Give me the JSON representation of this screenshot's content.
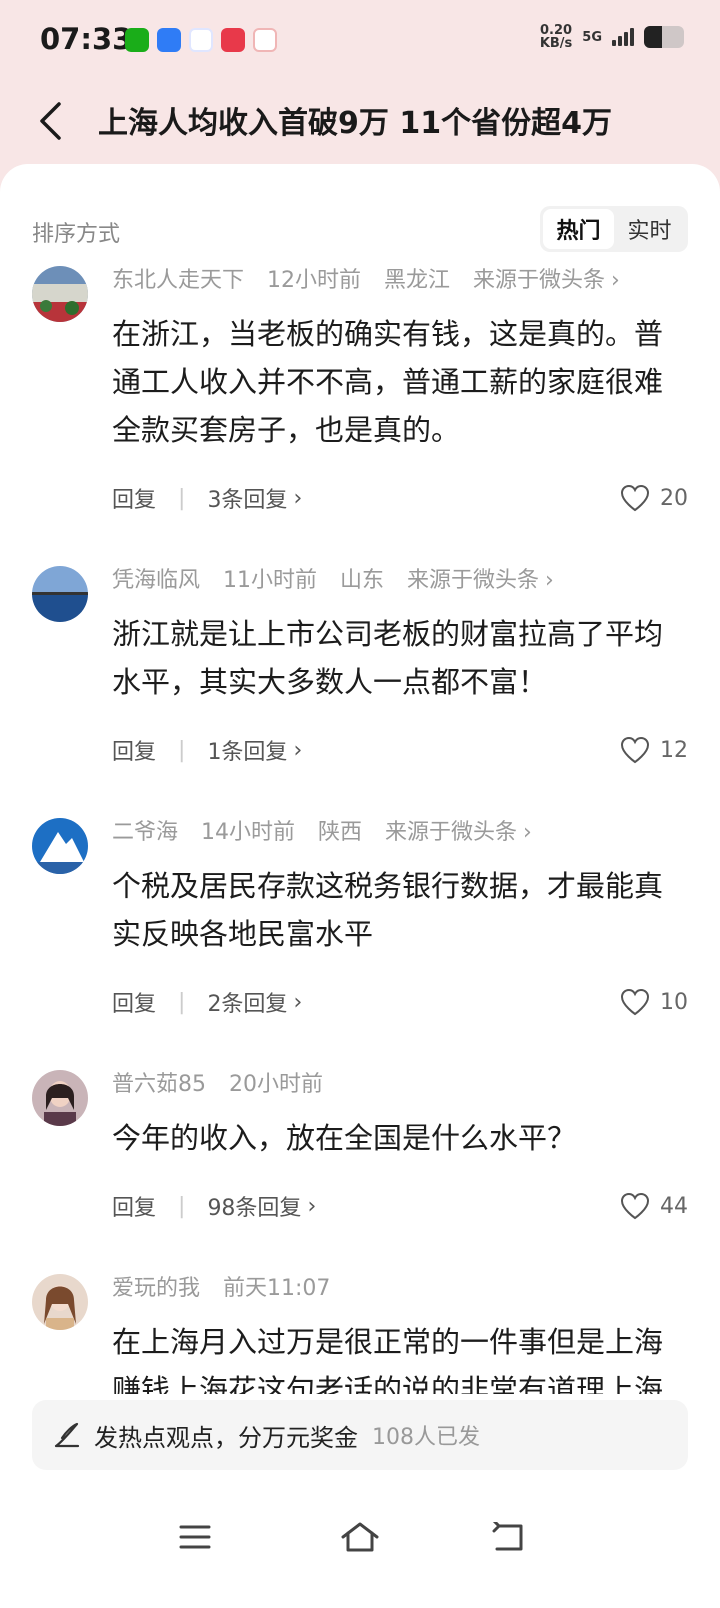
{
  "status_bar": {
    "time": "07:33",
    "speed_value": "0.20",
    "speed_unit": "KB/s",
    "network": "5G",
    "battery_level": 0.45,
    "app_icons": [
      "wechat-icon",
      "blue-app-icon",
      "dingtalk-icon",
      "red-app-icon",
      "red2-app-icon"
    ]
  },
  "header": {
    "title": "上海人均收入首破9万 11个省份超4万",
    "back_icon": "chevron-left-icon"
  },
  "sort": {
    "label": "排序方式",
    "options": [
      "热门",
      "实时"
    ],
    "active": "热门"
  },
  "comments": [
    {
      "user": "东北人走天下",
      "time": "12小时前",
      "location": "黑龙江",
      "source": "来源于微头条",
      "text": "在浙江，当老板的确实有钱，这是真的。普通工人收入并不不高，普通工薪的家庭很难全款买套房子，也是真的。",
      "reply_label": "回复",
      "replies": "3条回复",
      "likes": "20"
    },
    {
      "user": "凭海临风",
      "time": "11小时前",
      "location": "山东",
      "source": "来源于微头条",
      "text": "浙江就是让上市公司老板的财富拉高了平均水平，其实大多数人一点都不富！",
      "reply_label": "回复",
      "replies": "1条回复",
      "likes": "12"
    },
    {
      "user": "二爷海",
      "time": "14小时前",
      "location": "陕西",
      "source": "来源于微头条",
      "text": "个税及居民存款这税务银行数据，才最能真实反映各地民富水平",
      "reply_label": "回复",
      "replies": "2条回复",
      "likes": "10"
    },
    {
      "user": "普六茹85",
      "time": "20小时前",
      "location": "",
      "source": "",
      "text": "今年的收入，放在全国是什么水平？",
      "reply_label": "回复",
      "replies": "98条回复",
      "likes": "44"
    },
    {
      "user": "爱玩的我",
      "time": "前天11:07",
      "location": "",
      "source": "",
      "text": "在上海月入过万是很正常的一件事但是上海赚钱上海花这句老话的说的非常有道理上海虽然比全国平均工资高一点但是同时消费也是挺高的尤其是租房吃饭房租一个",
      "reply_label": "",
      "replies": "",
      "likes": ""
    }
  ],
  "post_bar": {
    "text": "发热点观点，分万元奖金",
    "count": "108人已发"
  },
  "colors": {
    "header_bg": "#f8e6e6",
    "card_bg": "#ffffff",
    "meta_text": "#9a9a9a"
  }
}
